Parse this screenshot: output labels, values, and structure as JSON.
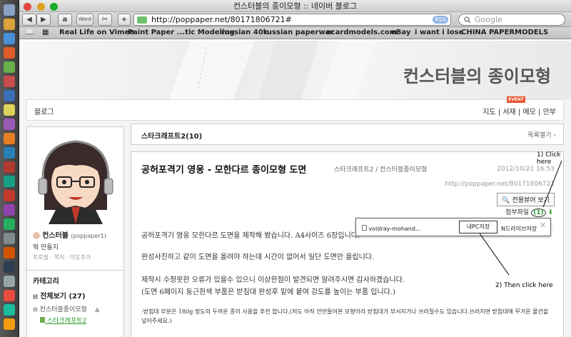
{
  "window": {
    "title": "컨스터블의 종이모형 :: 네이버 블로그"
  },
  "toolbar": {
    "url": "http://poppaper.net/80171806721#",
    "rss": "RSS",
    "search_placeholder": "Google",
    "back": "◀",
    "forward": "▶",
    "add": "+",
    "ext1": "a",
    "ext2": "Word",
    "ext3": "✂"
  },
  "bookmarks": [
    "Real Life on Vimeo",
    "Paint Paper ...tic Modeling",
    "russian 40k",
    "russian paperwar",
    "ecardmodels.com",
    "eBay",
    "i want i lose",
    "CHINA PAPERMODELS"
  ],
  "banner": {
    "title": "컨스터블의 종이모형"
  },
  "topnav": {
    "blog": "블로그",
    "links": "지도 | 서재 | 메모 | 안부",
    "event_badge": "EVENT"
  },
  "sidebar": {
    "nickname": "컨스터블",
    "user_id": "(poppaper1)",
    "greeting": "뭐 만들지",
    "profile_links": "프로필 · 쪽지 · 이웃추가",
    "category_header": "카테고리",
    "categories": [
      {
        "label": "전체보기 (27)"
      },
      {
        "label": "컨스터블종이모형"
      },
      {
        "label": "스타크래프트2"
      }
    ]
  },
  "category_bar": {
    "title": "스타크래프트2(10)",
    "list_open": "목록열기 ›"
  },
  "post": {
    "title": "공허포격기 영웅 - 모한다르 종이모형 도면",
    "category": "스타크래프트2 / 컨스터블종이모형",
    "date": "2012/10/21 16:53",
    "url": "http://poppaper.net/80171806721",
    "mobile_btn": "전용뷰어 보기",
    "attachment_label": "첨부파일",
    "attachment_count": "(1)",
    "paragraphs": [
      "공허포격기 영웅 모한다르 도면을 제작해 봤습니다. A4사이즈 6장입니다.",
      "완성사진하고 같이 도면을 올려야 하는데 시간이 없어서 일단 도면만 올립니다.",
      "제작시 수정못한 오류가 있을수 있으니 이상한점이 발견되면 알려주시면 감사하겠습니다.",
      "(도면 6페이지 둥근흰색 부품은 받침대 완성후 밑에 붙여 강도를 높이는 부품 입니다.)"
    ],
    "note": "-받침대 부분은 180g 정도의 두꺼운 종이 사용을 추천 합니다.(저도 아직 안만들어본 모형이라 받침대가 부서지거나 쓰러질수도 있습니다.쓰러지면 받침대에 무거운 물건을 넣어주세요.)"
  },
  "popup": {
    "file_name": "voidray-mohand...",
    "save_pc": "내PC저장",
    "save_ndrive": "N드라이브저장",
    "close": "✕"
  },
  "annotations": {
    "step1": "1) Click here",
    "step2": "2) Then click here"
  }
}
